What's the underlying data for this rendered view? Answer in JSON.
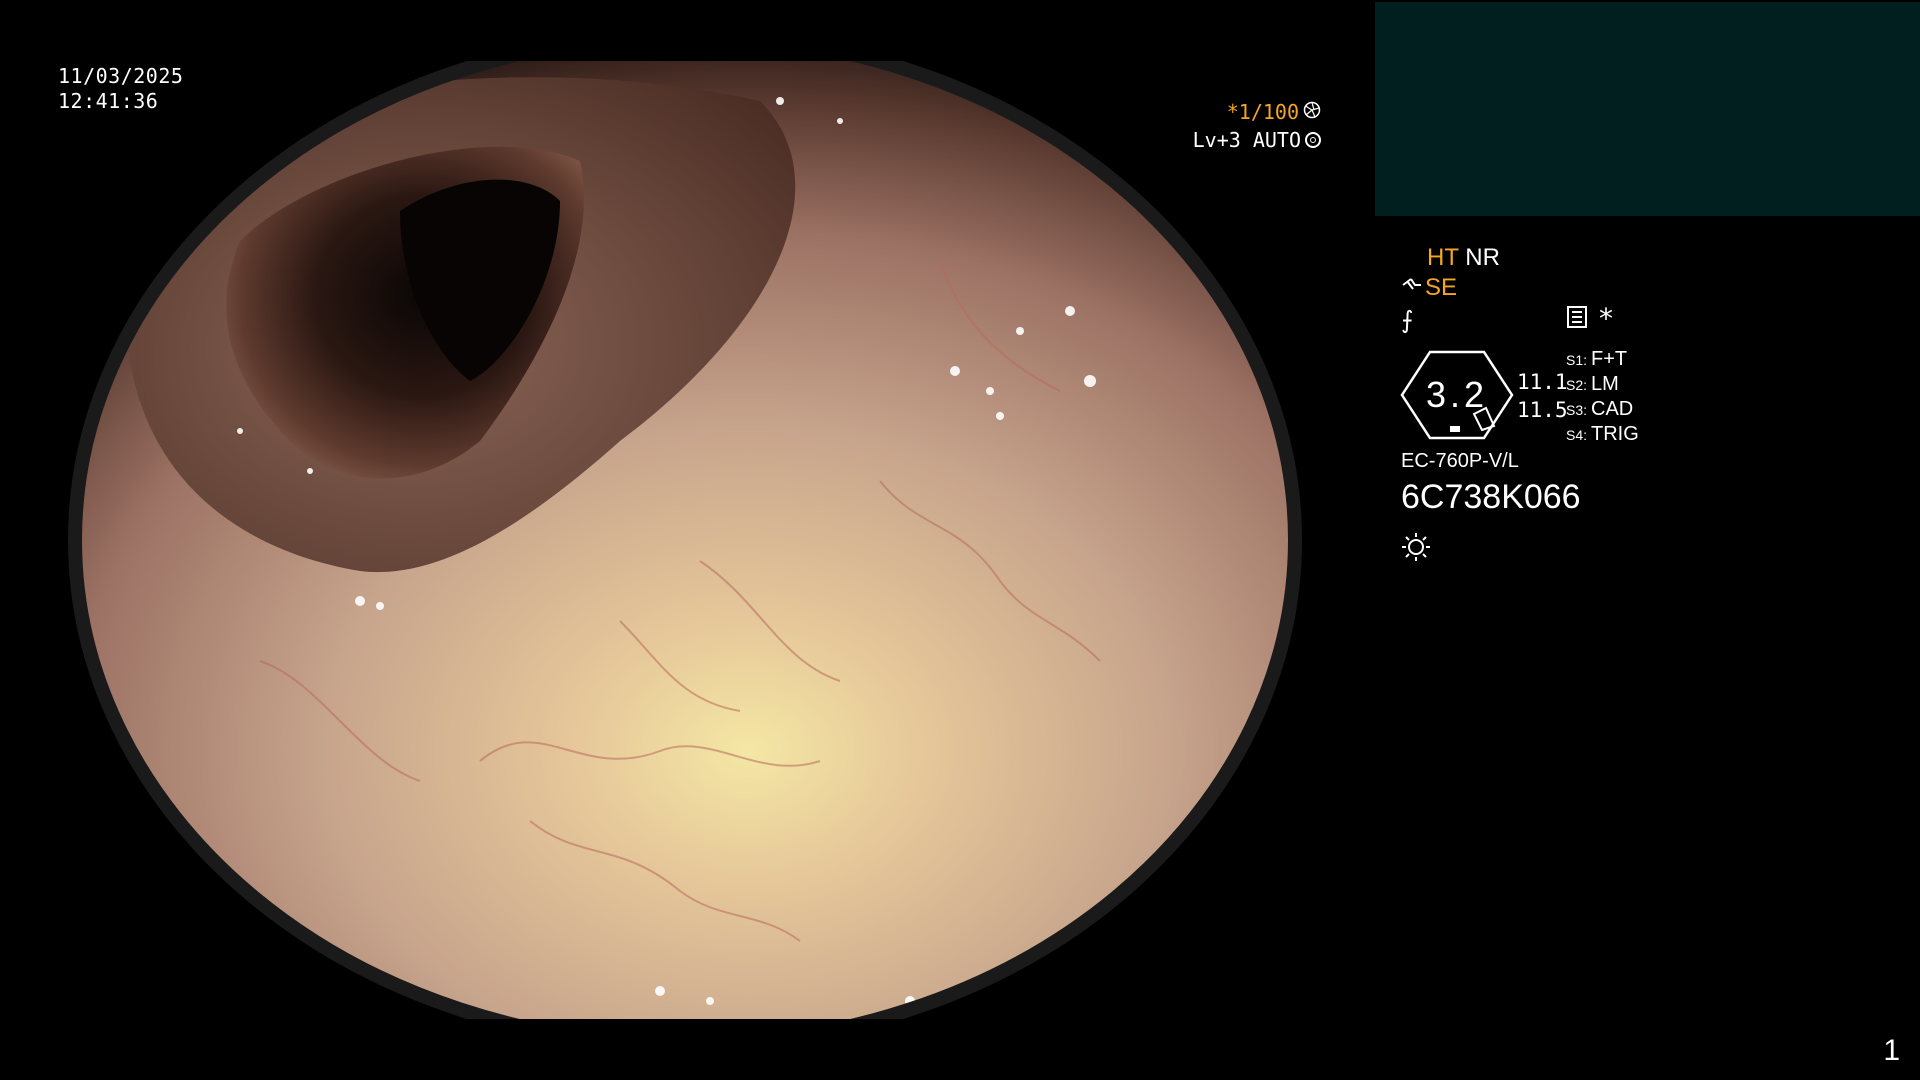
{
  "overlay": {
    "date": "11/03/2025",
    "time": "12:41:36",
    "zoom": "*1/100",
    "level": "Lv+3 AUTO"
  },
  "icons": {
    "shutter": "shutter-icon",
    "ring": "ring-icon",
    "flat": "flat-f-icon",
    "menu": "menu-icon",
    "light": "light-sun-icon"
  },
  "panel": {
    "ht": "HT",
    "nr": "NR",
    "se": "SE",
    "flat_glyph": "⨍",
    "asterisk": "*",
    "badge_value": "3.2",
    "value_a": "11.1",
    "value_b": "11.5",
    "slots": [
      {
        "key": "S1:",
        "label": "F+T"
      },
      {
        "key": "S2:",
        "label": "LM"
      },
      {
        "key": "S3:",
        "label": "CAD"
      },
      {
        "key": "S4:",
        "label": "TRIG"
      }
    ],
    "model": "EC-760P-V/L",
    "serial": "6C738K066"
  },
  "page_number": "1",
  "colors": {
    "accent_orange": "#f5a623",
    "panel_teal": "#021f1f",
    "background": "#000000"
  }
}
